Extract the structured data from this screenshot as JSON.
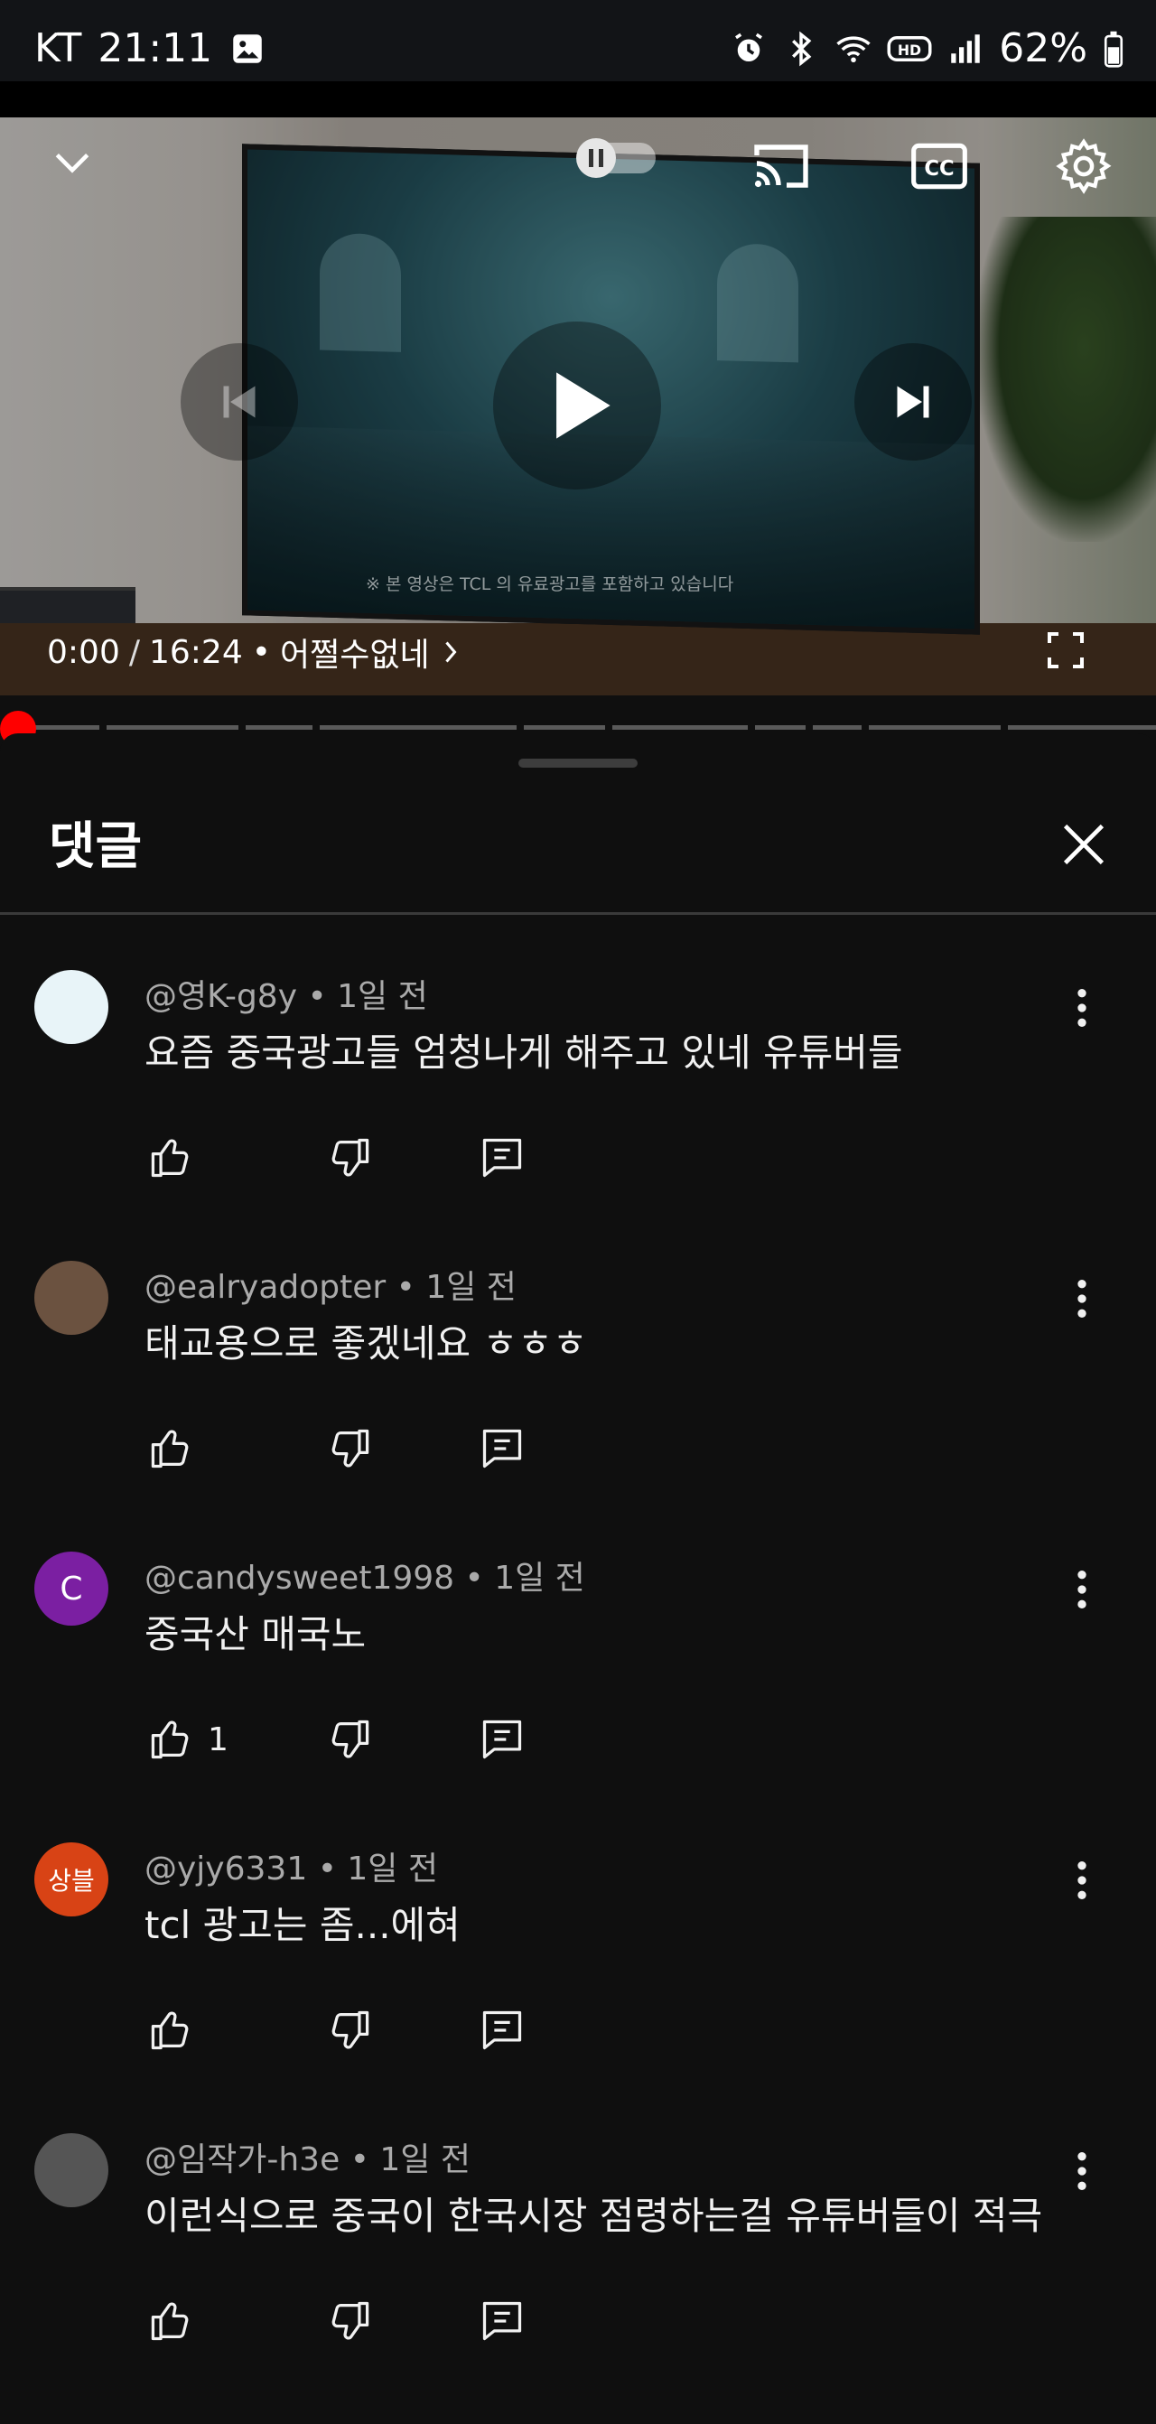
{
  "status_bar": {
    "carrier": "KT",
    "time": "21:11",
    "battery": "62%",
    "icons": [
      "gallery-icon",
      "alarm-icon",
      "bluetooth-icon",
      "wifi-icon",
      "hd-voice-icon",
      "signal-icon",
      "battery-icon"
    ]
  },
  "video": {
    "overlay_notice": "※ 본 영상은 TCL 의 유료광고를 포함하고 있습니다",
    "current_time": "0:00",
    "separator": "/",
    "duration": "16:24",
    "bullet": "•",
    "chapter": "어쩔수없네",
    "progress_fraction": 0.0
  },
  "comments_panel": {
    "title": "댓글"
  },
  "comments": [
    {
      "handle": "@영K-g8y",
      "time": "1일 전",
      "text": "요즘 중국광고들 엄청나게 해주고 있네 유튜버들",
      "likes": "",
      "avatar_letter": "",
      "avatar_color": "#e8f4f8"
    },
    {
      "handle": "@ealryadopter",
      "time": "1일 전",
      "text": "태교용으로 좋겠네요 ㅎㅎㅎ",
      "likes": "",
      "avatar_letter": "",
      "avatar_color": "#6b5240"
    },
    {
      "handle": "@candysweet1998",
      "time": "1일 전",
      "text": "중국산 매국노",
      "likes": "1",
      "avatar_letter": "C",
      "avatar_color": "#7b1fa2"
    },
    {
      "handle": "@yjy6331",
      "time": "1일 전",
      "text": "tcl 광고는 좀...에혀",
      "likes": "",
      "avatar_letter": "상블",
      "avatar_color": "#d84315"
    },
    {
      "handle": "@임작가-h3e",
      "time": "1일 전",
      "text": "이런식으로 중국이 한국시장 점령하는걸 유튜버들이 적극",
      "likes": "",
      "avatar_letter": "",
      "avatar_color": "#555555"
    }
  ],
  "colors": {
    "accent": "#ff0000",
    "background": "#0f0f0f",
    "meta_text": "#aaaaaa"
  }
}
